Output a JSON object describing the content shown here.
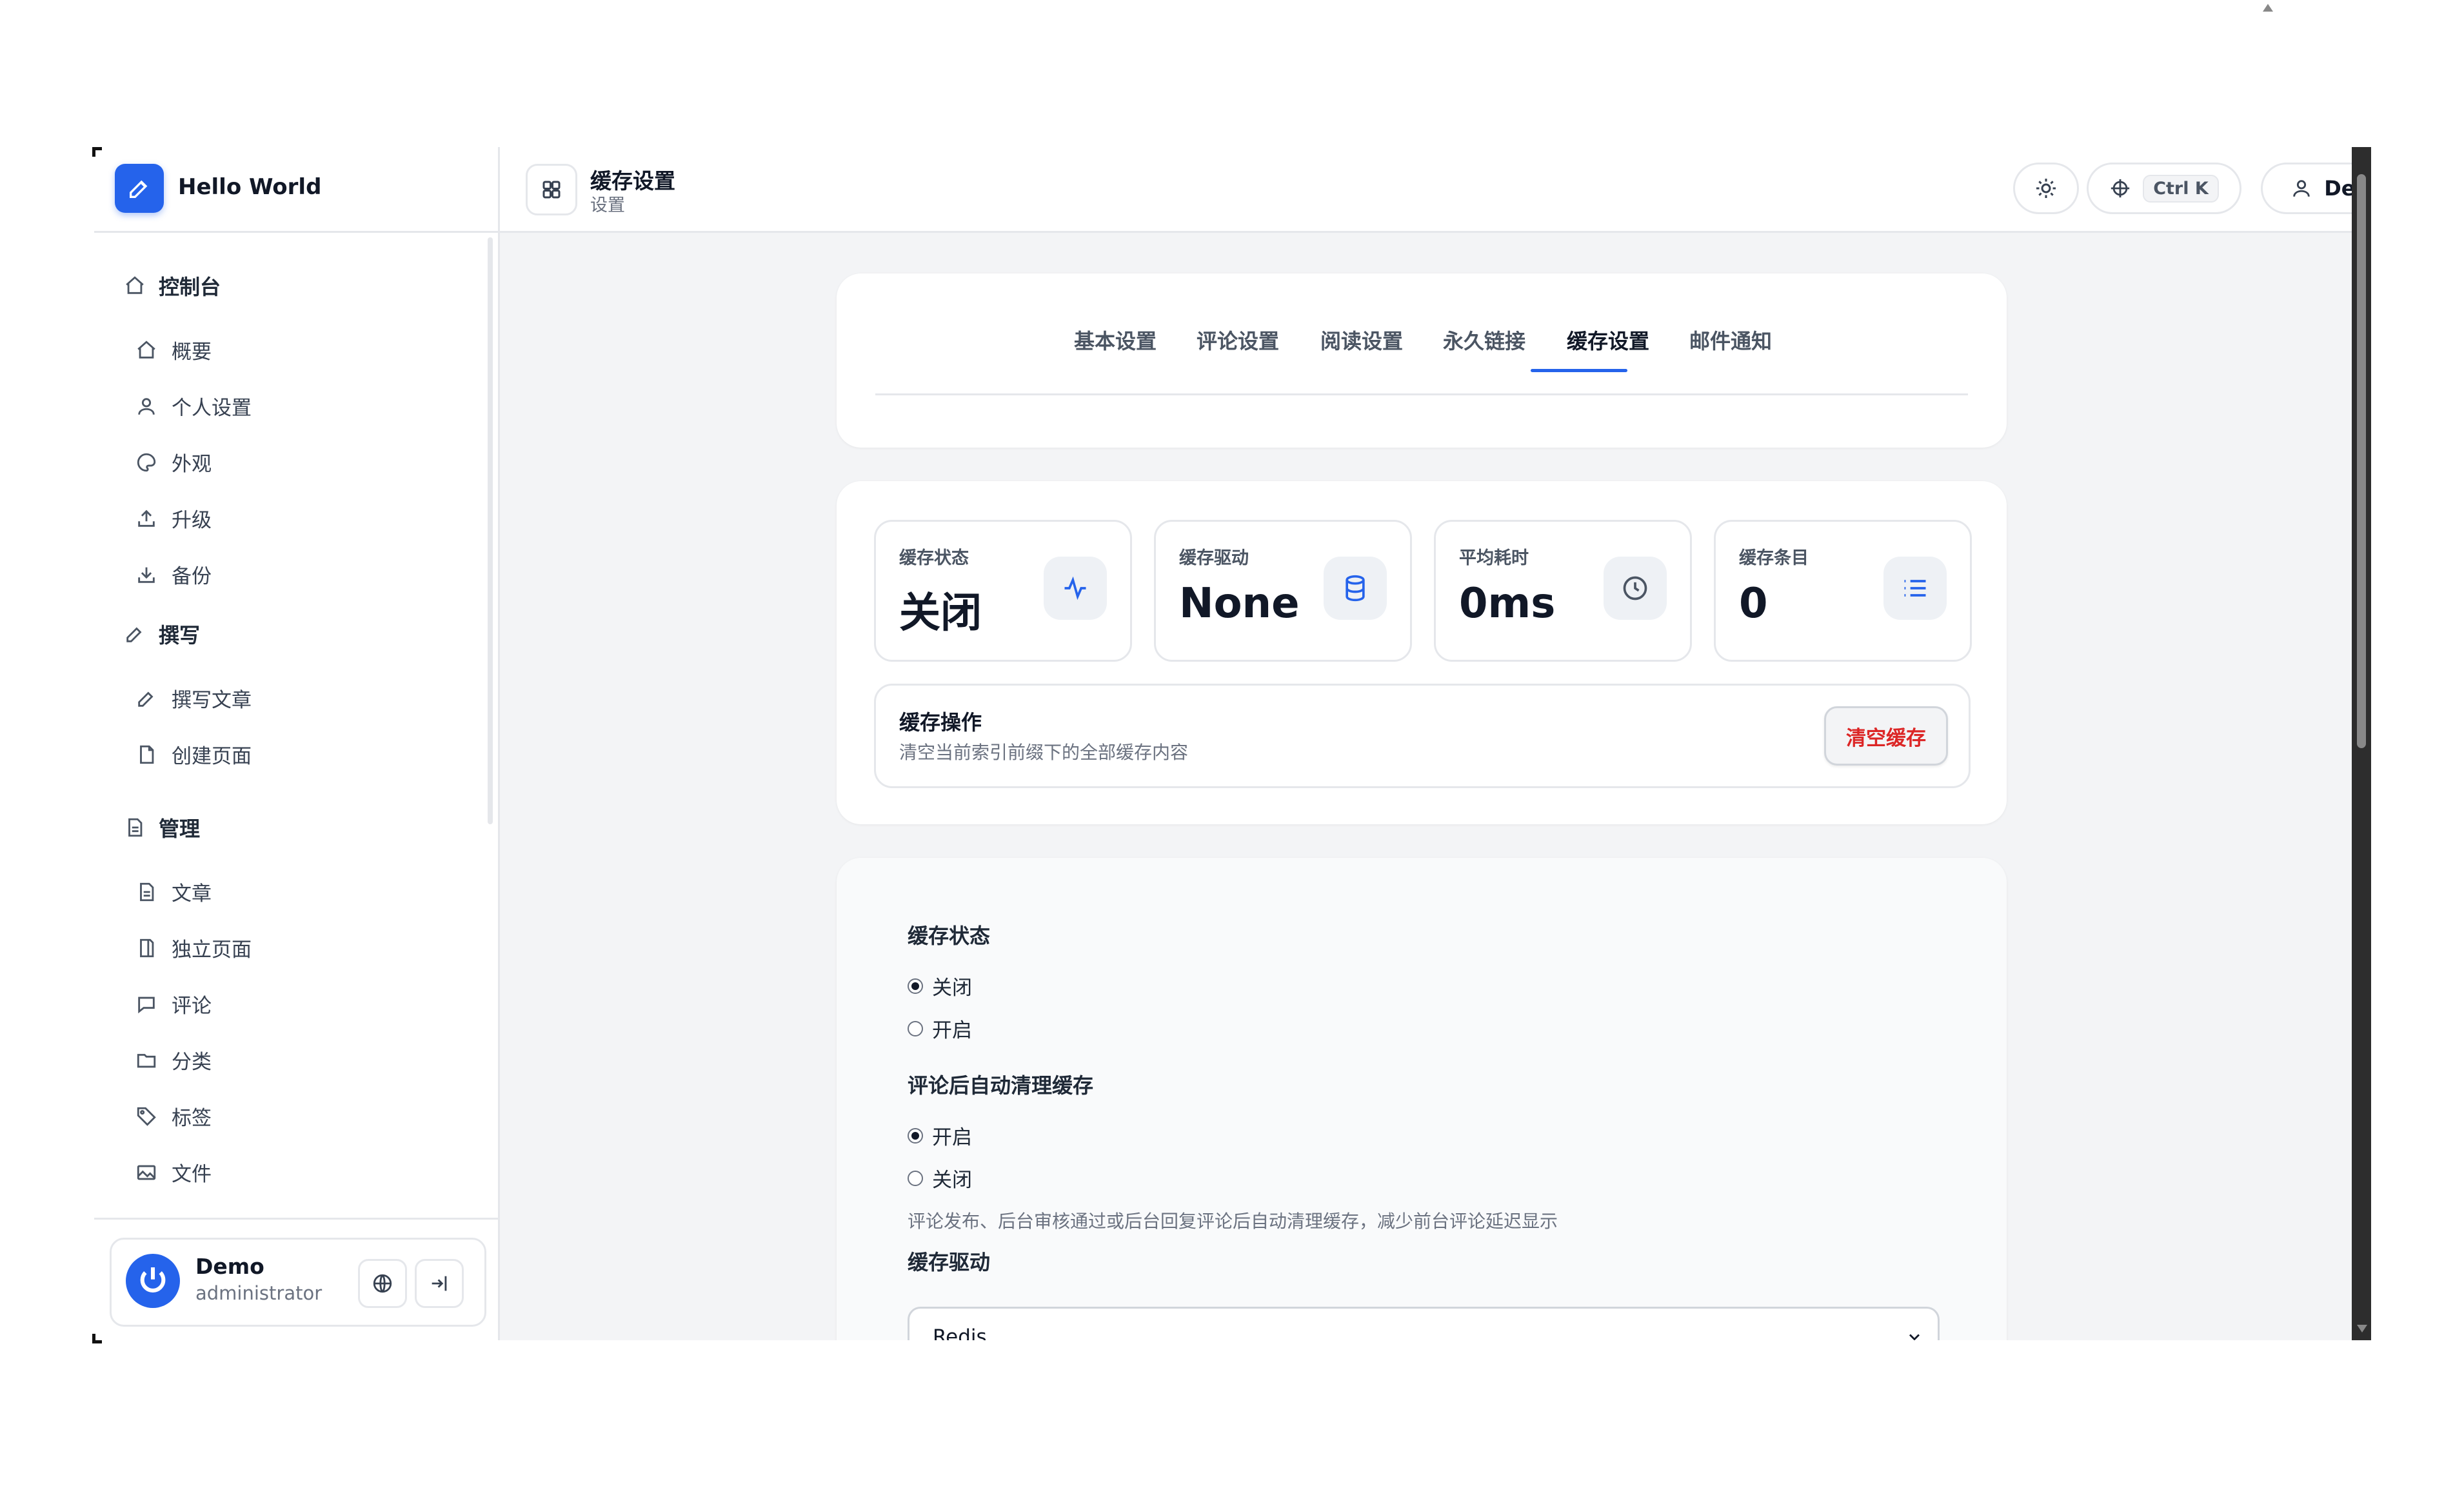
{
  "brand": {
    "name": "Hello World"
  },
  "colors": {
    "accent": "#2563eb",
    "danger": "#dc2626",
    "sidebar_bg": "#ffffff",
    "content_bg": "#f3f4f6"
  },
  "sidebar": {
    "groups": [
      {
        "label": "控制台",
        "icon": "home-icon",
        "items": [
          {
            "label": "概要",
            "icon": "home-icon"
          },
          {
            "label": "个人设置",
            "icon": "user-icon"
          },
          {
            "label": "外观",
            "icon": "palette-icon"
          },
          {
            "label": "升级",
            "icon": "upload-icon"
          },
          {
            "label": "备份",
            "icon": "download-icon"
          }
        ]
      },
      {
        "label": "撰写",
        "icon": "pen-icon",
        "items": [
          {
            "label": "撰写文章",
            "icon": "pen-icon"
          },
          {
            "label": "创建页面",
            "icon": "file-icon"
          }
        ]
      },
      {
        "label": "管理",
        "icon": "file-text-icon",
        "items": [
          {
            "label": "文章",
            "icon": "file-text-icon"
          },
          {
            "label": "独立页面",
            "icon": "files-icon"
          },
          {
            "label": "评论",
            "icon": "comment-icon"
          },
          {
            "label": "分类",
            "icon": "folder-icon"
          },
          {
            "label": "标签",
            "icon": "tag-icon"
          },
          {
            "label": "文件",
            "icon": "image-icon"
          }
        ]
      }
    ]
  },
  "user": {
    "name": "Demo",
    "role": "administrator"
  },
  "header": {
    "title": "缓存设置",
    "subtitle": "设置",
    "shortcut": "Ctrl K",
    "user_button": "Demo"
  },
  "tabs": [
    {
      "label": "基本设置",
      "active": false
    },
    {
      "label": "评论设置",
      "active": false
    },
    {
      "label": "阅读设置",
      "active": false
    },
    {
      "label": "永久链接",
      "active": false
    },
    {
      "label": "缓存设置",
      "active": true
    },
    {
      "label": "邮件通知",
      "active": false
    }
  ],
  "stats": [
    {
      "label": "缓存状态",
      "value": "关闭",
      "icon": "activity-icon"
    },
    {
      "label": "缓存驱动",
      "value": "None",
      "icon": "database-icon"
    },
    {
      "label": "平均耗时",
      "value": "0ms",
      "icon": "clock-icon"
    },
    {
      "label": "缓存条目",
      "value": "0",
      "icon": "list-icon"
    }
  ],
  "operation": {
    "title": "缓存操作",
    "description": "清空当前索引前缀下的全部缓存内容",
    "button": "清空缓存"
  },
  "form": {
    "cache_status": {
      "label": "缓存状态",
      "options": [
        "关闭",
        "开启"
      ],
      "selected": "关闭"
    },
    "auto_clear": {
      "label": "评论后自动清理缓存",
      "options": [
        "开启",
        "关闭"
      ],
      "selected": "开启",
      "help": "评论发布、后台审核通过或后台回复评论后自动清理缓存，减少前台评论延迟显示"
    },
    "driver": {
      "label": "缓存驱动",
      "value": "Redis"
    }
  }
}
